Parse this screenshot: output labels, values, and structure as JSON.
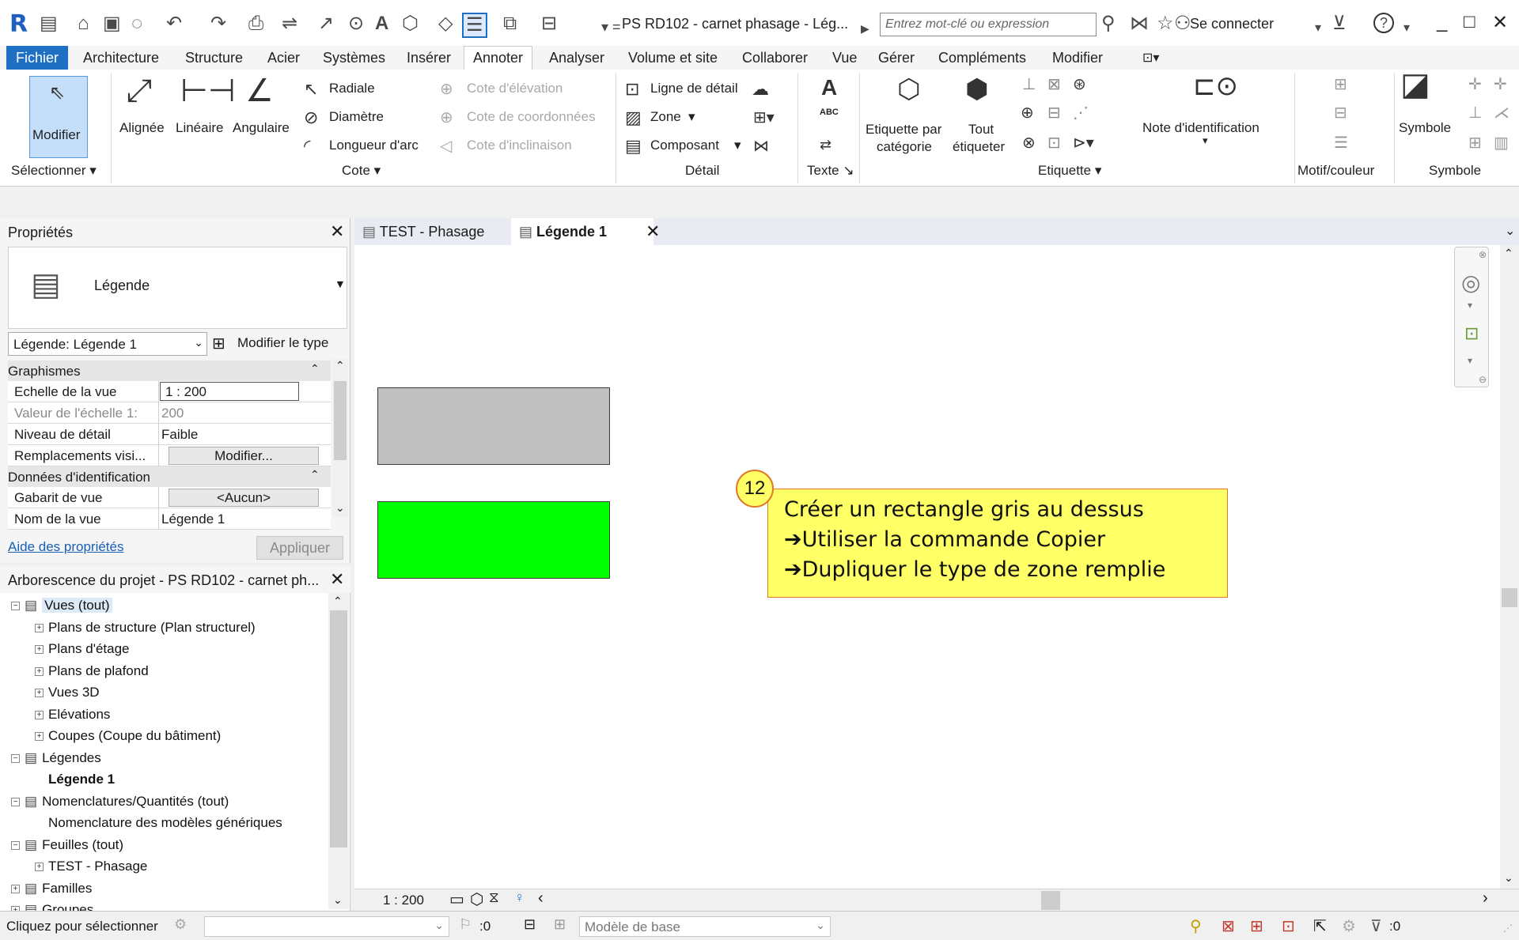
{
  "titlebar": {
    "app_logo": "R",
    "document_title": "PS RD102 - carnet phasage - Lég...",
    "search_placeholder": "Entrez mot-clé ou expression",
    "sign_in": "Se connecter",
    "help_symbol": "?"
  },
  "ribbon_tabs": [
    "Fichier",
    "Architecture",
    "Structure",
    "Acier",
    "Systèmes",
    "Insérer",
    "Annoter",
    "Analyser",
    "Volume et site",
    "Collaborer",
    "Vue",
    "Gérer",
    "Compléments",
    "Modifier"
  ],
  "active_tab": "Annoter",
  "ribbon": {
    "select": {
      "modify_label": "Modifier",
      "panel": "Sélectionner ▾"
    },
    "dimension": {
      "aligned": "Alignée",
      "linear": "Linéaire",
      "angular": "Angulaire",
      "radial": "Radiale",
      "diameter": "Diamètre",
      "arc_length": "Longueur d'arc",
      "spot_elevation": "Cote d'élévation",
      "spot_coordinate": "Cote de coordonnées",
      "spot_slope": "Cote d'inclinaison",
      "panel": "Cote ▾"
    },
    "detail": {
      "detail_line": "Ligne de détail",
      "region": "Zone",
      "component": "Composant",
      "panel": "Détail"
    },
    "text": {
      "icon_letter": "A",
      "abc": "ABC",
      "panel": "Texte ↘"
    },
    "tag": {
      "by_category_1": "Etiquette par",
      "by_category_2": "catégorie",
      "tag_all_1": "Tout",
      "tag_all_2": "étiqueter",
      "keynote": "Note d'identification",
      "panel": "Etiquette ▾"
    },
    "color_fill": {
      "panel": "Motif/couleur"
    },
    "symbol": {
      "label": "Symbole",
      "panel": "Symbole"
    }
  },
  "properties": {
    "title": "Propriétés",
    "type_name": "Légende",
    "type_selector": "Légende: Légende 1",
    "edit_type": "Modifier le type",
    "group_graphics": "Graphismes",
    "rows": [
      {
        "key": "Echelle de la vue",
        "value": "1 : 200"
      },
      {
        "key": "Valeur de l'échelle   1:",
        "value": "200"
      },
      {
        "key": "Niveau de détail",
        "value": "Faible"
      },
      {
        "key": "Remplacements visi...",
        "value": "Modifier..."
      }
    ],
    "group_identity": "Données d'identification",
    "rows2": [
      {
        "key": "Gabarit de vue",
        "value": "<Aucun>"
      },
      {
        "key": "Nom de la vue",
        "value": "Légende 1"
      }
    ],
    "help_link": "Aide des propriétés",
    "apply": "Appliquer"
  },
  "browser": {
    "title": "Arborescence du projet - PS RD102 - carnet ph...",
    "items": [
      {
        "label": "Vues (tout)",
        "level": 0,
        "expander": "−"
      },
      {
        "label": "Plans de structure (Plan structurel)",
        "level": 1,
        "expander": "+"
      },
      {
        "label": "Plans d'étage",
        "level": 1,
        "expander": "+"
      },
      {
        "label": "Plans de plafond",
        "level": 1,
        "expander": "+"
      },
      {
        "label": "Vues 3D",
        "level": 1,
        "expander": "+"
      },
      {
        "label": "Elévations",
        "level": 1,
        "expander": "+"
      },
      {
        "label": "Coupes (Coupe du bâtiment)",
        "level": 1,
        "expander": "+"
      },
      {
        "label": "Légendes",
        "level": 0,
        "expander": "−"
      },
      {
        "label": "Légende 1",
        "level": 1,
        "expander": ""
      },
      {
        "label": "Nomenclatures/Quantités (tout)",
        "level": 0,
        "expander": "−"
      },
      {
        "label": "Nomenclature des modèles génériques",
        "level": 1,
        "expander": ""
      },
      {
        "label": "Feuilles (tout)",
        "level": 0,
        "expander": "−"
      },
      {
        "label": "TEST - Phasage",
        "level": 1,
        "expander": "+"
      },
      {
        "label": "Familles",
        "level": 0,
        "expander": "+"
      },
      {
        "label": "Groupes",
        "level": 0,
        "expander": "+"
      }
    ]
  },
  "view_tabs": [
    {
      "label": "TEST - Phasage"
    },
    {
      "label": "Légende 1"
    }
  ],
  "note": {
    "number": "12",
    "line1": "Créer un rectangle gris au dessus",
    "line2": "➔Utiliser la commande Copier",
    "line3": "➔Dupliquer le type de zone remplie"
  },
  "view_control": {
    "scale": "1 : 200"
  },
  "status": {
    "message": "Cliquez pour sélectionner",
    "workset_count": ":0",
    "design_option": "Modèle de base",
    "filter_count": ":0"
  },
  "colors": {
    "file_tab": "#1f6fc4",
    "gray_fill": "#c0c0c0",
    "green_fill": "#00ff00",
    "note_fill": "#ffff66",
    "note_border": "#e07a2a"
  }
}
